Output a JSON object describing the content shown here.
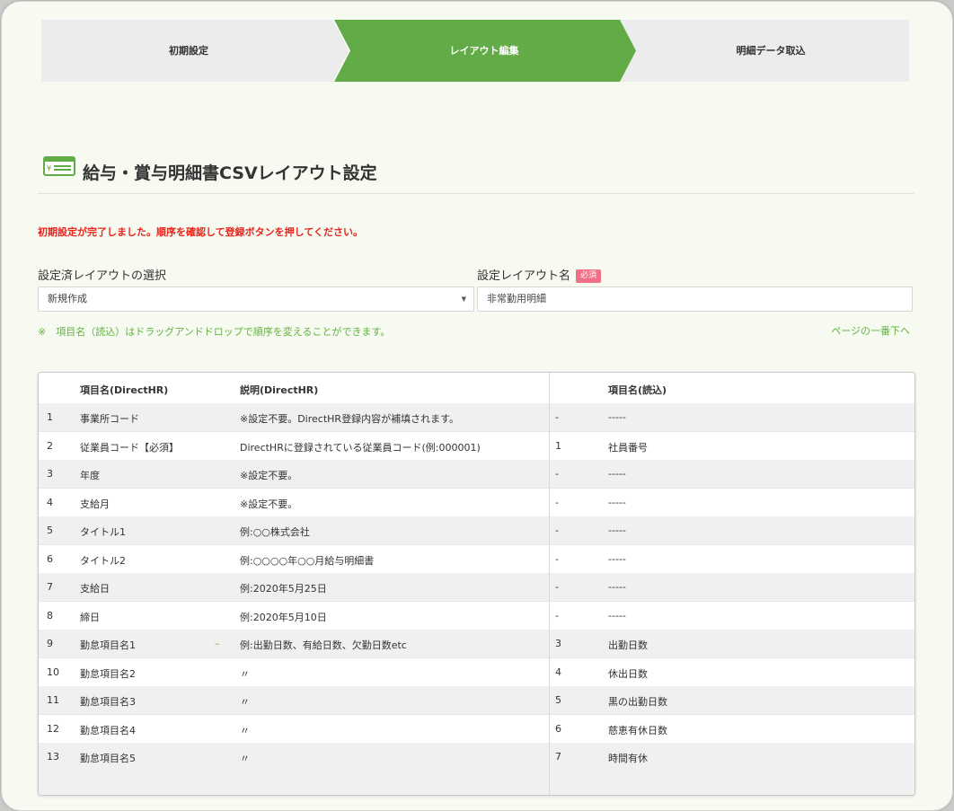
{
  "stepper": {
    "steps": [
      {
        "label": "初期設定",
        "active": false
      },
      {
        "label": "レイアウト編集",
        "active": true
      },
      {
        "label": "明細データ取込",
        "active": false
      }
    ],
    "active_color": "#62ab47",
    "inactive_color": "#ececec"
  },
  "page": {
    "title": "給与・賞与明細書CSVレイアウト設定",
    "icon": "payslip-icon",
    "notice": "初期設定が完了しました。順序を確認して登録ボタンを押してください。",
    "notice_color": "#e8241c"
  },
  "form": {
    "layout_select_label": "設定済レイアウトの選択",
    "layout_select_value": "新規作成",
    "layout_name_label": "設定レイアウト名",
    "required_badge": "必須",
    "layout_name_value": "非常勤用明細",
    "hint": "※　項目名（読込）はドラッグアンドドロップで順序を変えることができます。",
    "page_top_link": "ページの一番下へ",
    "accent_color": "#62b23d"
  },
  "table": {
    "headers": {
      "name": "項目名(DirectHR)",
      "desc": "説明(DirectHR)",
      "read": "項目名(読込)"
    },
    "rows": [
      {
        "num": "1",
        "name": "事業所コード",
        "desc": "※設定不要。DirectHR登録内容が補填されます。",
        "idx": "-",
        "read": "-----"
      },
      {
        "num": "2",
        "name": "従業員コード【必須】",
        "desc": "DirectHRに登録されている従業員コード(例:000001)",
        "idx": "1",
        "read": "社員番号"
      },
      {
        "num": "3",
        "name": "年度",
        "desc": "※設定不要。",
        "idx": "-",
        "read": "-----"
      },
      {
        "num": "4",
        "name": "支給月",
        "desc": "※設定不要。",
        "idx": "-",
        "read": "-----"
      },
      {
        "num": "5",
        "name": "タイトル1",
        "desc": "例:○○株式会社",
        "idx": "-",
        "read": "-----"
      },
      {
        "num": "6",
        "name": "タイトル2",
        "desc": "例:○○○○年○○月給与明細書",
        "idx": "-",
        "read": "-----"
      },
      {
        "num": "7",
        "name": "支給日",
        "desc": "例:2020年5月25日",
        "idx": "-",
        "read": "-----"
      },
      {
        "num": "8",
        "name": "締日",
        "desc": "例:2020年5月10日",
        "idx": "-",
        "read": "-----"
      },
      {
        "num": "9",
        "name": "勤怠項目名1",
        "desc": "例:出勤日数、有給日数、欠勤日数etc",
        "idx": "3",
        "read": "出勤日数",
        "dash": "–"
      },
      {
        "num": "10",
        "name": "勤怠項目名2",
        "desc": "〃",
        "idx": "4",
        "read": "休出日数"
      },
      {
        "num": "11",
        "name": "勤怠項目名3",
        "desc": "〃",
        "idx": "5",
        "read": "黒の出勤日数"
      },
      {
        "num": "12",
        "name": "勤怠項目名4",
        "desc": "〃",
        "idx": "6",
        "read": "慈恵有休日数"
      },
      {
        "num": "13",
        "name": "勤怠項目名5",
        "desc": "〃",
        "idx": "7",
        "read": "時間有休"
      }
    ]
  }
}
